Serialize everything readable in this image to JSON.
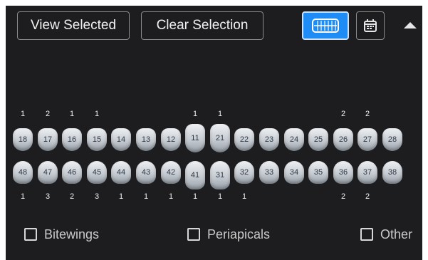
{
  "toolbar": {
    "view_selected": "View Selected",
    "clear_selection": "Clear Selection",
    "icons": {
      "teeth_view": "teeth-chart-icon",
      "calendar": "calendar-icon",
      "collapse": "chevron-up-icon"
    },
    "accent_color": "#1e8cf4"
  },
  "upper_teeth": [
    {
      "number": "18",
      "count": "1"
    },
    {
      "number": "17",
      "count": "2"
    },
    {
      "number": "16",
      "count": "1"
    },
    {
      "number": "15",
      "count": "1"
    },
    {
      "number": "14",
      "count": ""
    },
    {
      "number": "13",
      "count": ""
    },
    {
      "number": "12",
      "count": ""
    },
    {
      "number": "11",
      "count": "1"
    },
    {
      "number": "21",
      "count": "1"
    },
    {
      "number": "22",
      "count": ""
    },
    {
      "number": "23",
      "count": ""
    },
    {
      "number": "24",
      "count": ""
    },
    {
      "number": "25",
      "count": ""
    },
    {
      "number": "26",
      "count": "2"
    },
    {
      "number": "27",
      "count": "2"
    },
    {
      "number": "28",
      "count": ""
    }
  ],
  "lower_teeth": [
    {
      "number": "48",
      "count": "1"
    },
    {
      "number": "47",
      "count": "3"
    },
    {
      "number": "46",
      "count": "2"
    },
    {
      "number": "45",
      "count": "3"
    },
    {
      "number": "44",
      "count": "1"
    },
    {
      "number": "43",
      "count": "1"
    },
    {
      "number": "42",
      "count": "1"
    },
    {
      "number": "41",
      "count": "1"
    },
    {
      "number": "31",
      "count": "1"
    },
    {
      "number": "32",
      "count": "1"
    },
    {
      "number": "33",
      "count": ""
    },
    {
      "number": "34",
      "count": ""
    },
    {
      "number": "35",
      "count": ""
    },
    {
      "number": "36",
      "count": "2"
    },
    {
      "number": "37",
      "count": "2"
    },
    {
      "number": "38",
      "count": ""
    }
  ],
  "filters": {
    "bitewings": {
      "label": "Bitewings",
      "checked": false
    },
    "periapicals": {
      "label": "Periapicals",
      "checked": false
    },
    "other": {
      "label": "Other",
      "checked": false
    }
  }
}
